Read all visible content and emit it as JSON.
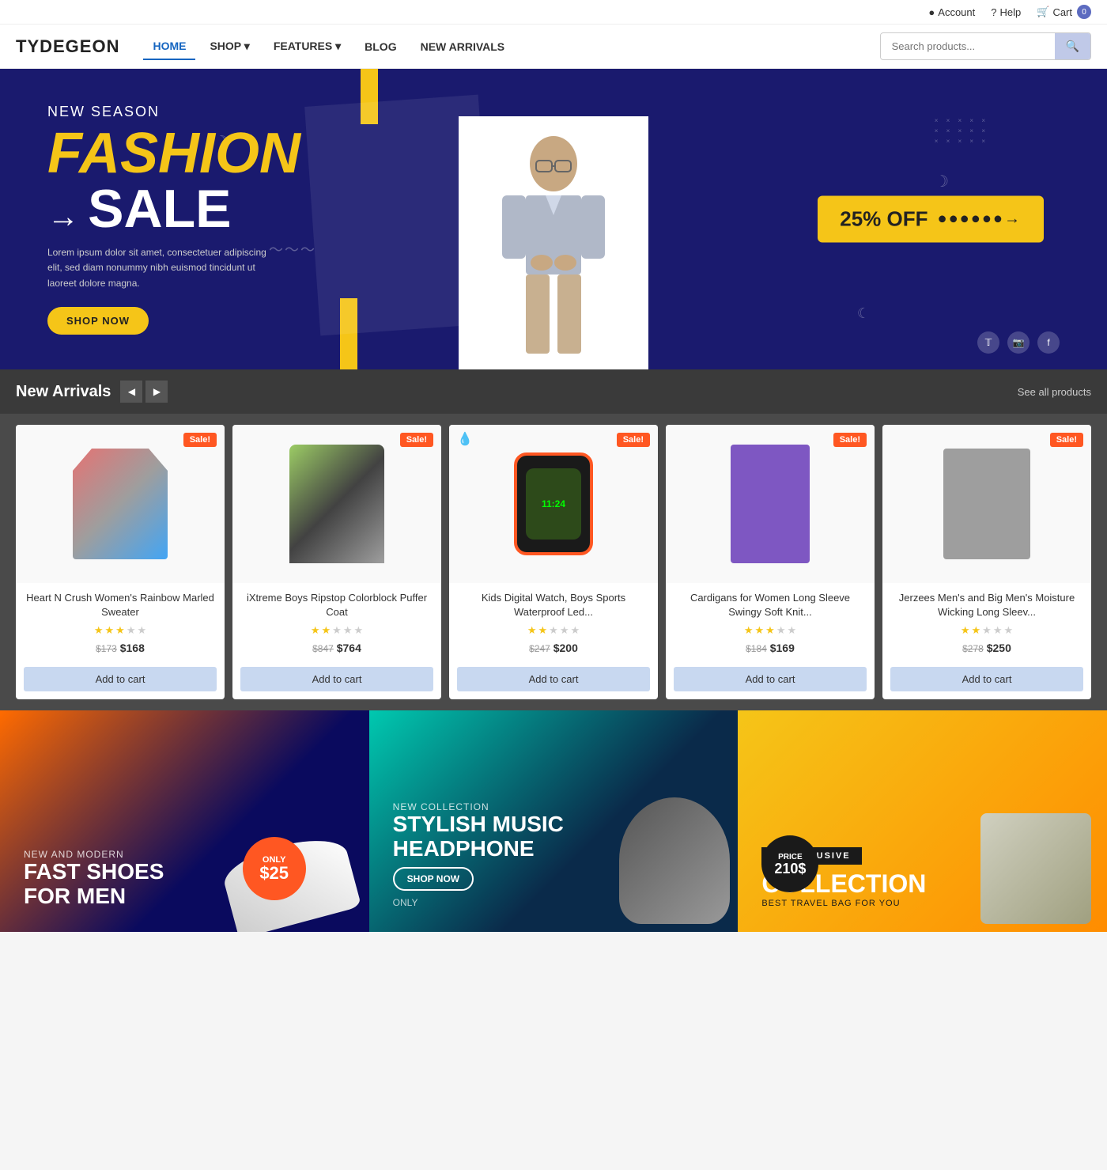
{
  "topbar": {
    "account_label": "Account",
    "help_label": "Help",
    "cart_label": "Cart",
    "cart_count": "0"
  },
  "header": {
    "logo": "TYDEGEON",
    "nav": [
      {
        "label": "HOME",
        "active": true
      },
      {
        "label": "SHOP",
        "has_dropdown": true
      },
      {
        "label": "FEATURES",
        "has_dropdown": true
      },
      {
        "label": "BLOG",
        "has_dropdown": false
      },
      {
        "label": "NEW ARRIVALS",
        "has_dropdown": false
      }
    ],
    "search_placeholder": "Search products..."
  },
  "hero": {
    "subtitle": "NEW SEASON",
    "title_fashion": "FASHION",
    "title_sale": "SALE",
    "description": "Lorem ipsum dolor sit amet, consectetuer adipiscing elit, sed diam nonummy nibh euismod tincidunt ut laoreet dolore magna.",
    "cta_button": "SHOP NOW",
    "discount_text": "25% OFF",
    "dots_arrow": "●●●●●●●●●→"
  },
  "new_arrivals": {
    "section_title": "New Arrivals",
    "see_all": "See all products",
    "prev_arrow": "◀",
    "next_arrow": "▶",
    "products": [
      {
        "name": "Heart N Crush Women's Rainbow Marled Sweater",
        "rating": 3,
        "max_rating": 5,
        "old_price": "$173",
        "new_price": "$168",
        "sale_badge": "Sale!",
        "add_to_cart": "Add to cart",
        "type": "sweater"
      },
      {
        "name": "iXtreme Boys Ripstop Colorblock Puffer Coat",
        "rating": 2,
        "max_rating": 5,
        "old_price": "$847",
        "new_price": "$764",
        "sale_badge": "Sale!",
        "add_to_cart": "Add to cart",
        "type": "jacket"
      },
      {
        "name": "Kids Digital Watch, Boys Sports Waterproof Led...",
        "rating": 2,
        "max_rating": 5,
        "old_price": "$247",
        "new_price": "$200",
        "sale_badge": "Sale!",
        "add_to_cart": "Add to cart",
        "type": "watch"
      },
      {
        "name": "Cardigans for Women Long Sleeve Swingy Soft Knit...",
        "rating": 3,
        "max_rating": 5,
        "old_price": "$184",
        "new_price": "$169",
        "sale_badge": "Sale!",
        "add_to_cart": "Add to cart",
        "type": "cardigan"
      },
      {
        "name": "Jerzees Men's and Big Men's Moisture Wicking Long Sleev...",
        "rating": 2,
        "max_rating": 5,
        "old_price": "$278",
        "new_price": "$250",
        "sale_badge": "Sale!",
        "add_to_cart": "Add to cart",
        "type": "longsleeve"
      }
    ]
  },
  "promos": [
    {
      "small_text": "NEW AND MODERN",
      "big_text": "FAST SHOES\nFOR MEN",
      "price_label": "ONLY",
      "price_value": "$25",
      "type": "shoes",
      "color": "orange"
    },
    {
      "small_text": "New Collection",
      "big_text": "STYLISH MUSIC\nHEADPHONE",
      "cta": "SHOP NOW",
      "only_label": "ONLY",
      "type": "headphone",
      "color": "teal"
    },
    {
      "exclusive_label": "EXCLUSIVE",
      "collection_text": "COLLECTION",
      "subtitle": "BEST TRAVEL BAG FOR YOU",
      "price_label": "PRICE",
      "price_value": "210$",
      "type": "bag",
      "color": "yellow"
    }
  ]
}
